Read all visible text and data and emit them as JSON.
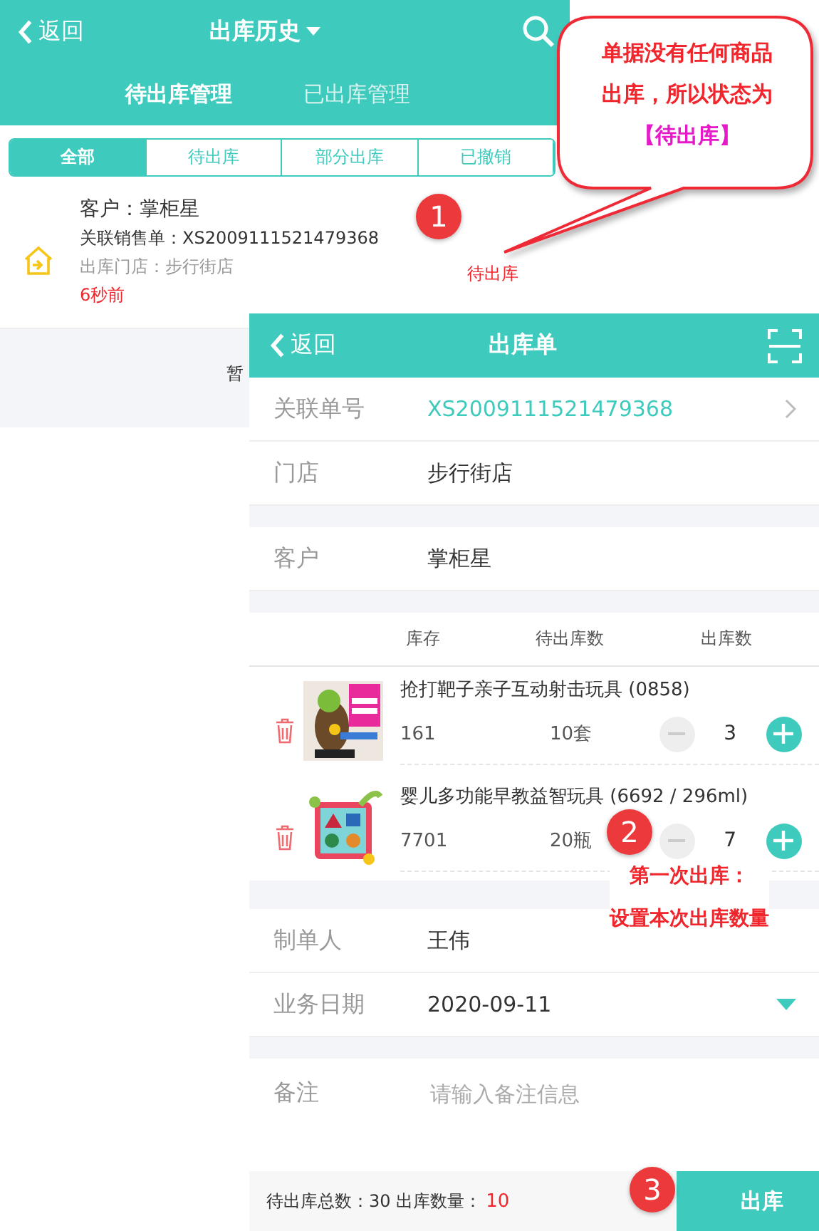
{
  "back_screen": {
    "back": "返回",
    "title": "出库历史",
    "tabs": [
      {
        "label": "待出库管理",
        "selected": true
      },
      {
        "label": "已出库管理",
        "selected": false
      }
    ],
    "filters": [
      {
        "label": "全部",
        "selected": true
      },
      {
        "label": "待出库",
        "selected": false
      },
      {
        "label": "部分出库",
        "selected": false
      },
      {
        "label": "已撤销",
        "selected": false
      }
    ],
    "record": {
      "customer": "客户：掌柜星",
      "sales_order": "关联销售单：XS2009111521479368",
      "store": "出库门店：步行街店",
      "time": "6秒前",
      "status": "待出库"
    },
    "empty_text": "暂"
  },
  "front_screen": {
    "back": "返回",
    "title": "出库单",
    "group_1": [
      {
        "label": "关联单号",
        "value": "XS2009111521479368",
        "kind": "link"
      },
      {
        "label": "门店",
        "value": "步行街店"
      }
    ],
    "group_2": [
      {
        "label": "客户",
        "value": "掌柜星"
      }
    ],
    "columns": [
      "库存",
      "待出库数",
      "出库数"
    ],
    "items": [
      {
        "kind": "picture",
        "name": "抢打靶子亲子互动射击玩具 (0858)",
        "stock": "161",
        "pending": "10套",
        "quantity": "3"
      },
      {
        "kind": "picture",
        "name": "婴儿多功能早教益智玩具 (6692 / 296ml)",
        "stock": "7701",
        "pending": "20瓶",
        "quantity": "7"
      }
    ],
    "group_3": [
      {
        "label": "制单人",
        "value": "王伟"
      },
      {
        "label": "业务日期",
        "value": "2020-09-11",
        "kind": "dropdown"
      }
    ],
    "remark": {
      "label": "备注",
      "placeholder": "请输入备注信息"
    },
    "footer": {
      "summary": "待出库总数：30 出库数量：",
      "quantity": "10",
      "button": "出库"
    }
  },
  "annotations": {
    "callout": [
      {
        "text": "单据没有任何商品",
        "kind": "normal"
      },
      {
        "text": "出库，所以状态为",
        "kind": "normal"
      },
      {
        "text": "【待出库】",
        "kind": "highlight"
      }
    ],
    "badges": [
      "1",
      "2",
      "3"
    ],
    "note": [
      "第一次出库：",
      "设置本次出库数量"
    ]
  }
}
